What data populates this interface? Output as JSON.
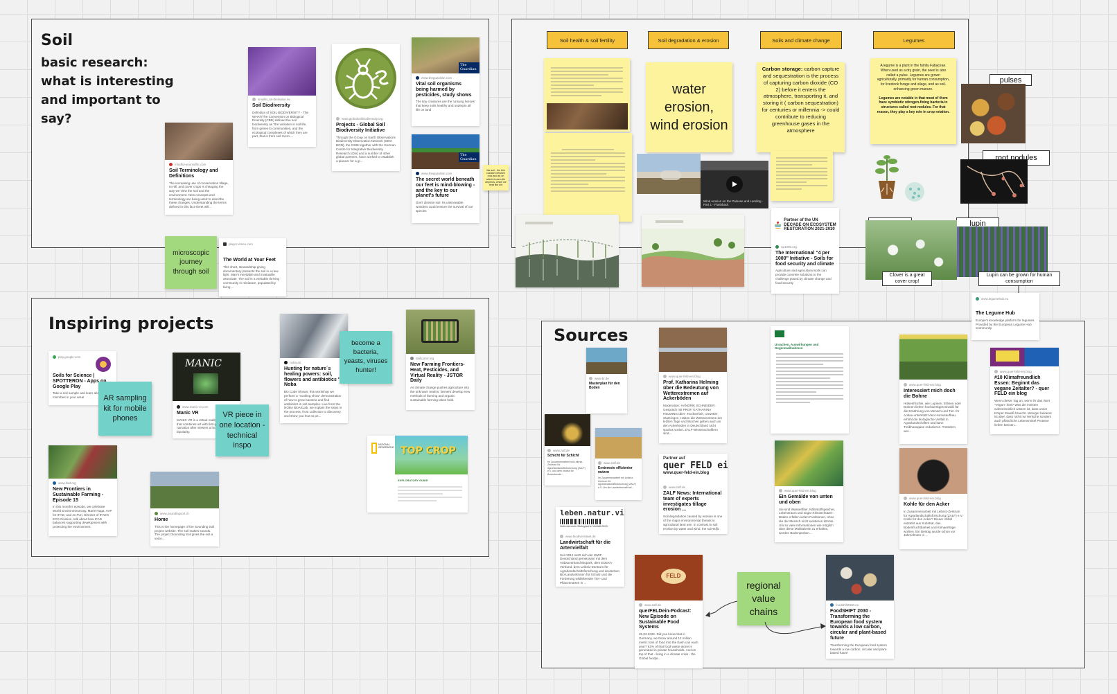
{
  "frames": {
    "soil": {
      "title": "Soil",
      "subtitle": "basic research: what is interesting and important to say?"
    },
    "inspiring": {
      "title": "Inspiring projects"
    },
    "sources": {
      "title": "Sources"
    }
  },
  "soil_cards": [
    {
      "source": "mindful-yeunkdfm.com",
      "title": "Soil Terminology and Definitions",
      "desc": "The increasing use of conservation tillage, no-till, and cover crops is changing the way we view the soil and the environment. New concepts and terminology are being used to describe these changes. Understanding the terms defined in this fact sheet will..."
    },
    {
      "source": "smallin_its-thelvalue.ne",
      "title": "Soil Biodiversity",
      "desc": "Definition of SOIL BIODIVERSITY - The WHAT/The Convention on Biological Diversity (CBD) defined the soil biodiversity as \"the variation in soil life, from genes to communities, and the ecological complexes of which they are part, that is from soil micro-..."
    },
    {
      "source": "www.globalsoilbiodiversity.org",
      "title": "Projects - Global Soil Biodiversity Initiative",
      "desc": "Through the Group on Earth Observations Biodiversity Observation Network (GEO BON), the GSBI together with the German Centre for Integrative Biodiversity Research (iDiv) and a number of other global partners, have worked to establish a pioneer for a gl..."
    },
    {
      "source": "www.theguardian.com",
      "title": "Vital soil organisms being harmed by pesticides, study shows",
      "desc": "The tiny creatures are the 'unsung heroes' that keep soils healthy and underpin all life on land"
    },
    {
      "source": "www.theguardian.com",
      "title": "The secret world beneath our feet is mind-blowing - and the key to our planet's future",
      "desc": "Don't dismiss soil. Its unknowable wonders could ensure the survival of our species"
    },
    {
      "source": "player.vimeo.com",
      "title": "The World at Your Feet",
      "desc": "This short, stewardship-giving documentary presents the soil in a new light. Man's inevitable and invaluable associate. The soil is a veritable thriving community in miniature, populated by living ..."
    }
  ],
  "soil_sticky_tiny": "like soil - the thin cushion between rock and air on which it seem life depends, which we treat like dirt",
  "soil_sticky_journey": "microscopic journey through soil",
  "topics": {
    "headers": [
      "Soil health & soil fertility",
      "Soil degradation & erosion",
      "Soils and climate change",
      "Legumes"
    ],
    "erosion_note": "water erosion, wind erosion",
    "climate_note_bold": "Carbon storage:",
    "climate_note_text": "carbon capture and sequestration is the process of capturing carbon dioxide (CO 2) before it enters the atmosphere, transporting it, and storing it ( carbon sequestration) for centuries or millennia -> could contribute to reducing greenhouse gases in the atmosphere",
    "legumes_note": "A legume is a plant in the family Fabaceae. When used as a dry grain, the seed is also called a pulse. Legumes are grown agriculturally, primarily for human consumption, for livestock forage and silage, and as soil-enhancing green manure.",
    "legumes_note_bold": "Legumes are notable in that most of them have symbiotic nitrogen-fixing bacteria in structures called root nodules. For that reason, they play a key role in crop rotation.",
    "video_caption": "Wind erosion on the Palouse and Landing - Part 1 - Flashback",
    "restoration_logo": "Partner of the UN DECADE ON ECOSYSTEM RESTORATION 2021-2030",
    "initiative_card": {
      "source": "4p1000.org",
      "title": "The International \"4 per 1000\" Initiative - Soils for food security and climate",
      "desc": "Agriculture and agricultural soils can provide concrete solutions to the challenge posed by climate change and food security"
    },
    "legume_hub": {
      "source": "www.legumehub.eu",
      "title": "The Legume Hub",
      "desc": "Europe's knowledge platform for legumes. Provided by the European Legume Hub Community"
    }
  },
  "legume_labels": {
    "pulses": "pulses",
    "root_nodules": "root nodules",
    "clover": "clover",
    "lupin": "lupin",
    "clover_note": "Clover is a great cover crop!",
    "lupin_note": "Lupin can be grown for human consumption"
  },
  "inspiring_cards": [
    {
      "source": "play.google.com",
      "title": "Soils for Science | SPOTTERON - Apps on Google Play",
      "desc": "Take a soil sample and learn about microbes in your area!"
    },
    {
      "source": "www.manic-vr.com",
      "title": "Manic VR",
      "desc": "MANIC VR is a virtual reality experience that combines art with first-person audio narration after viewers a look into bipolarity."
    },
    {
      "source": "noba.art",
      "title": "Hunting for nature´s healing powers: soil, flowers and antibiotics \" Noba",
      "desc": "Bio Code Shown: this workshop we perform a \"cooking show\" demonstration of how to grow bacteria and find antibiotics in soil samples. Live from the NOBA BioArtLab, we explain the steps in the process, from collection to discovery, and show you how to pe..."
    },
    {
      "source": "daily.jstor.org",
      "title": "New Farming Frontiers-Heat, Pesticides, and Virtual Reality - JSTOR Daily",
      "desc": "As climate change pushes agriculture into the unknown realms, farmers develop new methods of farming and organic sustainable farming takes hold."
    },
    {
      "source": "www.ifad.org",
      "title": "New Frontiers in Sustainable Farming - Episode 15",
      "desc": "In this month's episode, we celebrate World Environment Day. Marie Haga, AVP for IFAD, and Jo Puri, Director of IFAD's ECG Division, talk about how IFAD balances supporting development with protecting the environment."
    },
    {
      "source": "www.soundingsoil.ch",
      "title": "Home",
      "desc": "This is the homepage of the Sounding Soil project website. The soil makes sounds. The project Sounding Soil gives the soil a voice..."
    }
  ],
  "inspiring_stickies": {
    "ar": "AR sampling kit for mobile phones",
    "vr": "VR piece in one location - technical inspo",
    "bacteria": "become a bacteria, yeasts, viruses hunter!"
  },
  "topcrop": {
    "logo": "NATIONAL GEOGRAPHIC",
    "title": "TOP CROP",
    "sub": "EXPLORATORY GUIDE"
  },
  "sources_cards": [
    {
      "source": "www.br.de",
      "title": "Masterplan für den Boden",
      "desc": ""
    },
    {
      "source": "www.quer-feld-ein.blog",
      "title": "Prof. Katharina Helming über die Bedeutung von Wetterextremen auf Ackerböden",
      "desc": "Moderation: HANDRIK SCHNEIDER. Gespräch mit PROF. KATHARINA HELMING über: Trockenheit, Unwetter, Starkregen. Haben die Wetterextreme der letzten Tage und Wochen gehen auch an den Ackerböden in Deutschland nicht spurlos vorbei. ZALF-Wissenschaftlern sind..."
    },
    {
      "source": "www.zalf.de",
      "title": "Schicht für Schicht",
      "desc": "Im Zusammenarbeit mit Leibniz-Zentrum für Agrarlandschaftsforschung (ZALF) e.V. und dem Institut für Bodenkunde..."
    },
    {
      "source": "www.zalf.de",
      "title": "Erntereste effizienter nutzen",
      "desc": "Im Zusammenarbeit mit Leibniz-Zentrum für Agrarlandschaftsforschung (ZALF) e.V. Um die Landwirtschaft bei..."
    },
    {
      "source": "www.zalf.de",
      "title": "ZALF News: International team of experts investigates tillage erosion ...",
      "desc": "Soil degradation caused by erosion is one of the major environmental threats in agricultural land use. In contrast to soil erosion by water and wind, the scientific knowledge about erosion caused by tillage operations is still limited. Therefore, main..."
    },
    {
      "source": "www.biodiversitaet.de",
      "title": "Landwirtschaft für die Artenvielfalt",
      "desc": "Seit 2012 setzt sich der WWF Deutschland gemeinsam mit dem Anbauverband Biopark, dem EDEKA-Verbund, dem Leibniz-Zentrum für Agrarlandschaftsforschung und deutschen Bio-Landwirtinnen für Schutz und die Förderung wildlebender Tier- und Pflanzenarten in ..."
    },
    {
      "source": "www.quer-feld-ein.blog",
      "title": "Ein Gemälde von unten und oben",
      "desc": "Sie sind Wasserfilter, Nährstoffspeicher, Lebensraum und sogar Klimaschützer: Böden erfüllen vielen Funktionen, ohne die der Mensch nicht existieren könnte. Um so viele Informationen wie möglich über diese Multitalente zu erhalten, werden Bodenproben..."
    },
    {
      "source": "www.quer-feld-ein.blog",
      "title": "Interessiert mich doch die Bohne",
      "desc": "Hülsenfrüchte, wie Lupinen, Erbsen oder Bohnen liefern hochwertiges Eiweiß für die Ernährung von Mensch und Tier. Ihr Anbau unterstützt den Humusaufbau, erhöht die biologische Vielfalt in Agrarlandschaften und kann Treibhausgase reduzieren. Trotzdem wer..."
    },
    {
      "source": "www.quer-feld-ein.blog",
      "title": "Kohle für den Acker",
      "desc": "In Zusammenarbeit mit Leibniz-Zentrum für Agrarlandschaftsforschung (ZALF) e.V. Kohle für den Acker? Dieser Abfall entsteht aus Substrat, das Bodenfruchtbarkeit und Klimaerträge wohlen. Ein Beitrag wurde schon vor Jahrzehnten in ..."
    },
    {
      "source": "www.quer-feld-ein.blog",
      "title": "#10 Klimafreundlich Essen: Beginnt das vegane Zeitalter? - quer FELD ein blog",
      "desc": "Wenn dieser Tag an, wenn ihr das Wort \"Vegan\" hört? Was die meisten wahrscheinlich wissen ist, dass unser Körper Eiweiß braucht. Weniger bekannt ist aber, dass nicht nur tierische sondern auch pflanzliche Lebensmittel Proteine liefern können..."
    },
    {
      "source": "www.zalf.de",
      "title": "querFELDein-Podcast: New Episode on Sustainable Food Systems",
      "desc": "25.03.2022. Did you know that in Germany, we throw around 12 million metric tons of food into the trash can each year? 62% of that food waste alone is generated in private households. And on top of that - living in a climate crisis - the Global foodpr..."
    },
    {
      "source": "foodshift2030.eu",
      "title": "FoodSHIFT 2030 - Transforming the European food system towards a low carbon, circular and plant-based future",
      "desc": "Transforming the European food system towards a low carbon, circular and plant-based future"
    }
  ],
  "sources_extra": {
    "leben": "leben.natur.vielfalt",
    "leben_sub": "Unternehmen Biologische Vielfalt 2020",
    "partner_auf": "Partner auf",
    "quer_feld": "quer FELD ein",
    "quer_url": "www.quer-feld-ein.blog",
    "feld": "FELD",
    "doc_title": "Ursachen, Auswirkungen und Gegenmaßnahmen",
    "regional": "regional value chains"
  },
  "colors": {
    "green_sticky": "#a3d97e",
    "teal_sticky": "#72d1c8",
    "yellow_sticky": "#fdf39c",
    "orange_label": "#f5c23a",
    "grid": "#dcdcdc",
    "frame_border": "#4b4b4b"
  }
}
